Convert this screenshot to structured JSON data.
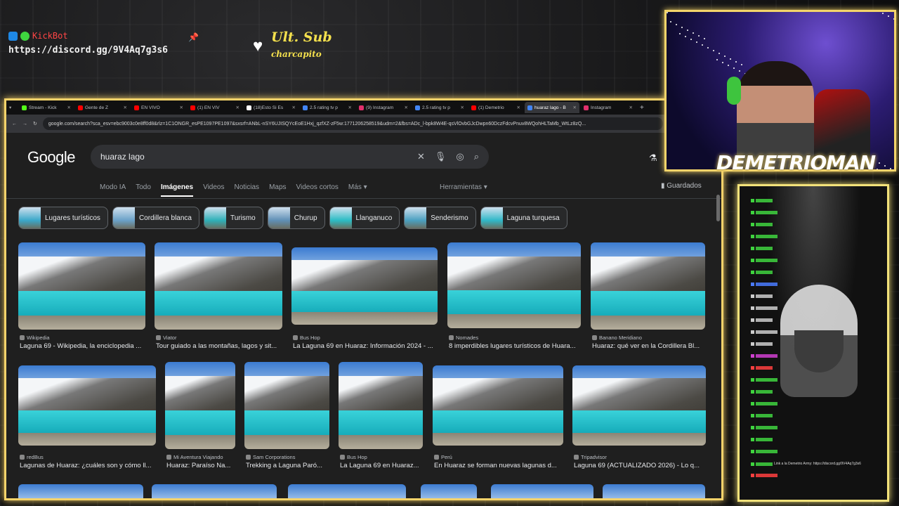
{
  "overlay": {
    "bot_name": "KickBot",
    "bot_link": "https://discord.gg/9V4Aq7g3s6",
    "sub_label": "Ult. Sub",
    "sub_user": "charcapito"
  },
  "browser": {
    "tabs": [
      {
        "label": "Stream - Kick",
        "color": "#53fc18"
      },
      {
        "label": "Gente de Z",
        "color": "#ff0000"
      },
      {
        "label": "EN VIVO",
        "color": "#ff0000"
      },
      {
        "label": "(1) EN VIV",
        "color": "#ff0000"
      },
      {
        "label": "(18)Esto Si Es",
        "color": "#ffffff"
      },
      {
        "label": "2.5 rating tv p",
        "color": "#4285f4"
      },
      {
        "label": "(9) Instagram",
        "color": "#e1306c"
      },
      {
        "label": "2.5 rating tv p",
        "color": "#4285f4"
      },
      {
        "label": "(1) Demetrio",
        "color": "#ff0000"
      },
      {
        "label": "huaraz lago - B",
        "color": "#4285f4",
        "active": true
      },
      {
        "label": "Instagram",
        "color": "#e1306c"
      }
    ],
    "new_tab": "+",
    "url": "google.com/search?sca_esv=ebc9003c0e8ff0d8&rlz=1C1ONGR_esPE1097PE1097&sxsrf=ANbL-nSY6UJISQYcEoE1Hxj_qzfXZ-zF5w:1771206258519&udm=2&fbs=ADc_l-bpk8W4E-qsVlOvbGJcDwpn60DczFdcvPnuv8WQohHLTaMb_WtLz8zQ..."
  },
  "google": {
    "logo": "Google",
    "query": "huaraz lago",
    "nav": [
      "Modo IA",
      "Todo",
      "Imágenes",
      "Videos",
      "Noticias",
      "Maps",
      "Videos cortos",
      "Más ▾"
    ],
    "tools": "Herramientas ▾",
    "saved": "Guardados",
    "chips": [
      "Lugares turísticos",
      "Cordillera blanca",
      "Turismo",
      "Churup",
      "Llanganuco",
      "Senderismo",
      "Laguna turquesa"
    ],
    "row1": [
      {
        "source": "Wikipedia",
        "caption": "Laguna 69 - Wikipedia, la enciclopedia ..."
      },
      {
        "source": "Viator",
        "caption": "Tour guiado a las montañas, lagos y sit..."
      },
      {
        "source": "Bus Hop",
        "caption": "La Laguna 69 en Huaraz: Información 2024 - ..."
      },
      {
        "source": "Nomades",
        "caption": "8 imperdibles lugares turísticos de Huara..."
      },
      {
        "source": "Banano Meridiano",
        "caption": "Huaraz: qué ver en la Cordillera Bl..."
      }
    ],
    "row2": [
      {
        "source": "redBus",
        "caption": "Lagunas de Huaraz: ¿cuáles son y cómo ll..."
      },
      {
        "source": "Mi Aventura Viajando",
        "caption": "Huaraz: Paraíso Na..."
      },
      {
        "source": "Sam Corporations",
        "caption": "Trekking a Laguna Paró..."
      },
      {
        "source": "Bus Hop",
        "caption": "La Laguna 69 en Huaraz..."
      },
      {
        "source": "Perú",
        "caption": "En Huaraz se forman nuevas lagunas d..."
      },
      {
        "source": "Tripadvisor",
        "caption": "Laguna 69 (ACTUALIZADO 2026) - Lo q..."
      }
    ]
  },
  "stream": {
    "streamer_name": "DEMETRIOMAN",
    "chat_tail": "Link a la Demetrio Army: https://discord.gg/9V4Aq7g3s6"
  }
}
